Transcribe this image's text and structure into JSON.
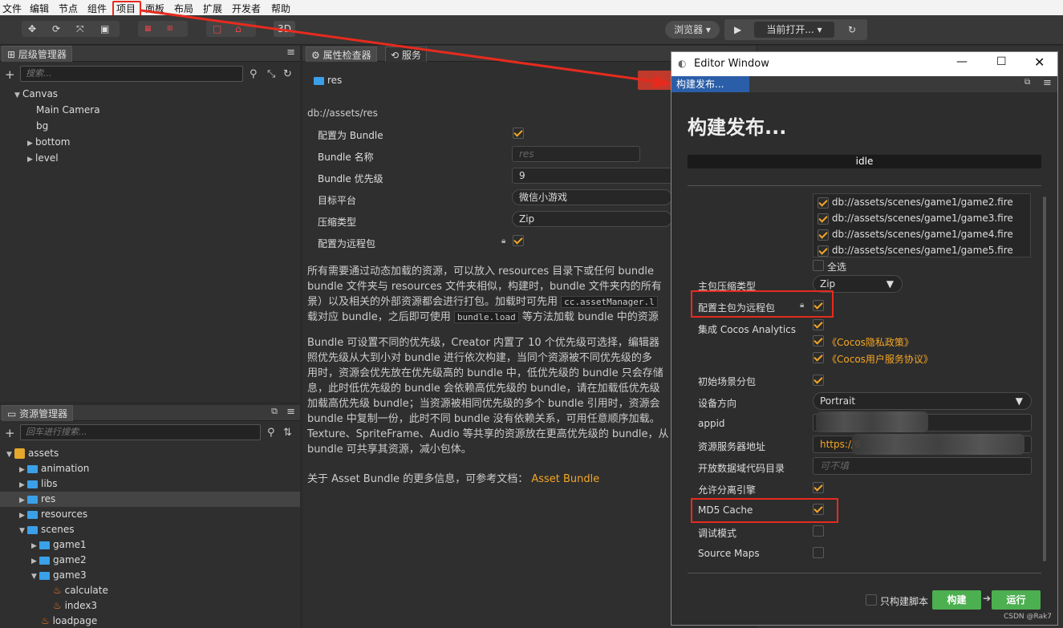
{
  "menu": [
    "文件",
    "编辑",
    "节点",
    "组件",
    "项目",
    "面板",
    "布局",
    "扩展",
    "开发者",
    "帮助"
  ],
  "toolbar": {
    "mode_3d": "3D",
    "browser": "浏览器",
    "current_open": "当前打开..."
  },
  "hierarchy": {
    "title": "层级管理器",
    "search_placeholder": "搜索...",
    "nodes": [
      "Canvas",
      "Main Camera",
      "bg",
      "bottom",
      "level"
    ]
  },
  "assets": {
    "title": "资源管理器",
    "search_placeholder": "回车进行搜索...",
    "items": [
      "assets",
      "animation",
      "libs",
      "res",
      "resources",
      "scenes",
      "game1",
      "game2",
      "game3",
      "calculate",
      "index3",
      "loadpage"
    ]
  },
  "inspector": {
    "tab_props": "属性检查器",
    "tab_service": "服务",
    "node_name": "res",
    "path": "db://assets/res",
    "fields": {
      "is_bundle_label": "配置为 Bundle",
      "bundle_name_label": "Bundle 名称",
      "bundle_name_placeholder": "res",
      "priority_label": "Bundle 优先级",
      "priority_value": "9",
      "platform_label": "目标平台",
      "platform_value": "微信小游戏",
      "compress_label": "压缩类型",
      "compress_value": "Zip",
      "remote_label": "配置为远程包"
    },
    "para1_a": "所有需要通过动态加载的资源，可以放入 resources 目录下或任何 bundle",
    "para1_b": "bundle 文件夹与 resources 文件夹相似，构建时，bundle 文件夹内的所有",
    "para1_c": "景）以及相关的外部资源都会进行打包。加载时可先用",
    "para1_code1": "cc.assetManager.l",
    "para1_d": "载对应 bundle，之后即可使用",
    "para1_code2": "bundle.load",
    "para1_e": "等方法加载 bundle 中的资源",
    "para2_lines": [
      "Bundle 可设置不同的优先级，Creator 内置了 10 个优先级可选择，编辑器",
      "照优先级从大到小对 bundle 进行依次构建，当同个资源被不同优先级的多",
      "用时，资源会优先放在优先级高的 bundle 中，低优先级的 bundle 只会存储",
      "息，此时低优先级的 bundle 会依赖高优先级的 bundle，请在加载低优先级",
      "加载高优先级 bundle；当资源被相同优先级的多个 bundle 引用时，资源会",
      "bundle 中复制一份，此时不同 bundle 没有依赖关系，可用任意顺序加载。",
      "Texture、SpriteFrame、Audio 等共享的资源放在更高优先级的 bundle，从",
      "bundle 可共享其资源，减小包体。"
    ],
    "more_info": "关于 Asset Bundle 的更多信息，可参考文档：",
    "more_link": "Asset Bundle"
  },
  "editor_window": {
    "title": "Editor Window",
    "tab": "构建发布...",
    "heading": "构建发布...",
    "status": "idle",
    "scenes": [
      "db://assets/scenes/game1/game2.fire",
      "db://assets/scenes/game1/game3.fire",
      "db://assets/scenes/game1/game4.fire",
      "db://assets/scenes/game1/game5.fire"
    ],
    "select_all": "全选",
    "main_compress_label": "主包压缩类型",
    "main_compress_value": "Zip",
    "main_remote_label": "配置主包为远程包",
    "analytics_label": "集成 Cocos Analytics",
    "privacy": "《Cocos隐私政策》",
    "user_agreement": "《Cocos用户服务协议》",
    "subpackage_label": "初始场景分包",
    "orientation_label": "设备方向",
    "orientation_value": "Portrait",
    "appid_label": "appid",
    "server_label": "资源服务器地址",
    "server_value": "https://6",
    "opendata_label": "开放数据域代码目录",
    "opendata_placeholder": "可不填",
    "separate_engine_label": "允许分离引擎",
    "md5_label": "MD5 Cache",
    "debug_label": "调试模式",
    "sourcemaps_label": "Source Maps",
    "build_script_only": "只构建脚本",
    "build_btn": "构建",
    "run_btn": "运行"
  },
  "watermark": "CSDN @Rak7",
  "colors": {
    "accent_orange": "#f5a623",
    "highlight_red": "#e62b1e",
    "build_green": "#4caf50"
  }
}
